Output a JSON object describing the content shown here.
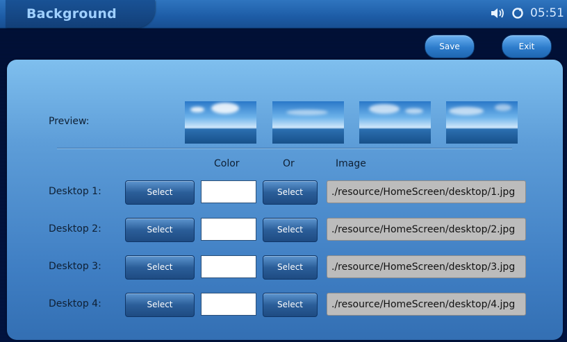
{
  "header": {
    "title": "Background",
    "time": "05:51"
  },
  "toolbar": {
    "save_label": "Save",
    "exit_label": "Exit"
  },
  "preview": {
    "label": "Preview:",
    "thumbnails": [
      "desktop 1 preview",
      "desktop 2 preview",
      "desktop 3 preview",
      "desktop 4 preview"
    ]
  },
  "columns": {
    "color": "Color",
    "or": "Or",
    "image": "Image"
  },
  "desktops": [
    {
      "label": "Desktop 1:",
      "select_label": "Select",
      "image_select_label": "Select",
      "color": "#ffffff",
      "path": "./resource/HomeScreen/desktop/1.jpg"
    },
    {
      "label": "Desktop 2:",
      "select_label": "Select",
      "image_select_label": "Select",
      "color": "#ffffff",
      "path": "./resource/HomeScreen/desktop/2.jpg"
    },
    {
      "label": "Desktop 3:",
      "select_label": "Select",
      "image_select_label": "Select",
      "color": "#ffffff",
      "path": "./resource/HomeScreen/desktop/3.jpg"
    },
    {
      "label": "Desktop 4:",
      "select_label": "Select",
      "image_select_label": "Select",
      "color": "#ffffff",
      "path": "./resource/HomeScreen/desktop/4.jpg"
    }
  ],
  "icons": {
    "volume": "speaker-icon",
    "sync": "sync-icon"
  }
}
